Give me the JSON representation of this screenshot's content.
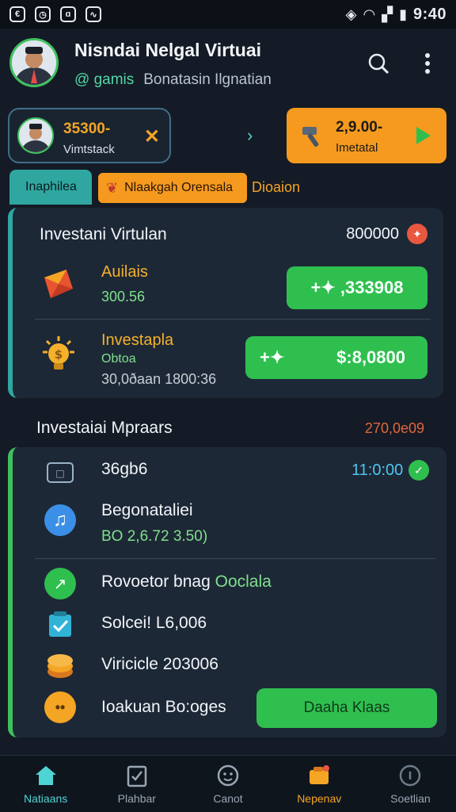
{
  "status_bar": {
    "time": "9:40"
  },
  "header": {
    "name": "Nisndai Nelgal Virtuai",
    "handle": "@ gamis",
    "subtitle": "Bonatasin Ilgnatian"
  },
  "quick_row": {
    "mini_card": {
      "amount": "35300-",
      "label": "Vimtstack"
    },
    "orange_card": {
      "amount": "2,9.00-",
      "label": "Imetatal"
    }
  },
  "tabs": [
    {
      "label": "Inaphilea"
    },
    {
      "label": "Nlaakgah Orensala"
    },
    {
      "label": "Dioaion"
    }
  ],
  "investment_card": {
    "title": "Investani Virtulan",
    "value": "800000",
    "rows": [
      {
        "title": "Auilais",
        "sub": "300.56",
        "button": "+✦ ,333908"
      },
      {
        "title": "Investapla",
        "sub": "Obtoa",
        "sub2": "30,0ðaan 1800:36",
        "button": "$:8,0800"
      }
    ]
  },
  "section2": {
    "title": "Investaiai Mpraars",
    "meta": "270,0e09"
  },
  "list": [
    {
      "text": "36gb6",
      "right": "11:0:00"
    },
    {
      "text": "Begonataliei",
      "sub": "BO 2,6.72 3.50)"
    },
    {
      "text": "Rovoetor bnag",
      "green": "Ooclala"
    },
    {
      "text": "Solcei! L6,006"
    },
    {
      "text": "Viricicle 203006"
    },
    {
      "text": "Ioakuan Bo:oges",
      "button": "Daaha Klaas"
    }
  ],
  "bottom_nav": [
    {
      "label": "Natiaans"
    },
    {
      "label": "Plahbar"
    },
    {
      "label": "Canot"
    },
    {
      "label": "Nepenav"
    },
    {
      "label": "Soetlian"
    }
  ]
}
